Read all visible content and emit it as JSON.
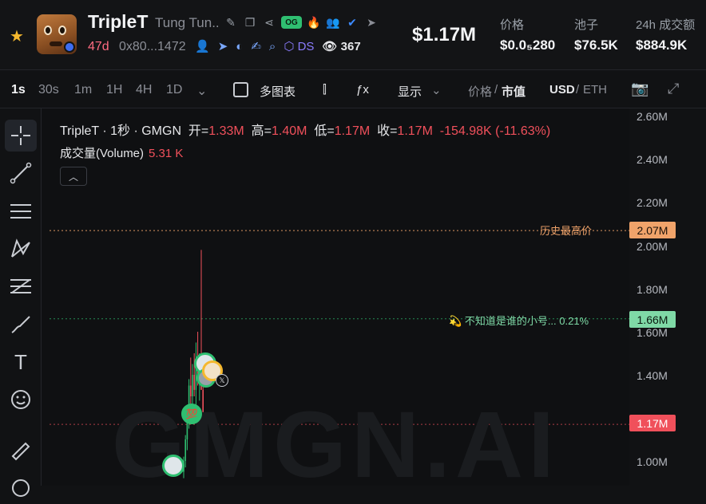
{
  "header": {
    "title": "TripleT",
    "subtitle": "Tung Tun...",
    "og_badge": "OG",
    "age": "47d",
    "address": "0x80...1472",
    "ds_label": "DS",
    "views": "367",
    "price_big": "$1.17M",
    "stats": [
      {
        "label": "价格",
        "value": "$0.0₅280"
      },
      {
        "label": "池子",
        "value": "$76.5K"
      },
      {
        "label": "24h 成交额",
        "value": "$884.9K"
      }
    ]
  },
  "toolbar": {
    "timeframes": [
      "1s",
      "30s",
      "1m",
      "1H",
      "4H",
      "1D"
    ],
    "active_timeframe": "1s",
    "multi_chart": "多图表",
    "display": "显示",
    "price_label": "价格",
    "slash": "/",
    "mcap_label": "市值",
    "usd": "USD",
    "eth": "ETH"
  },
  "legend": {
    "symbol": "TripleT · 1秒 · GMGN",
    "open_label": "开=",
    "open": "1.33M",
    "high_label": "高=",
    "high": "1.40M",
    "low_label": "低=",
    "low": "1.17M",
    "close_label": "收=",
    "close": "1.17M",
    "change": "-154.98K (-11.63%)",
    "volume_label": "成交量(Volume)",
    "volume": "5.31 K"
  },
  "chart": {
    "watermark": "GMGN.AI",
    "ath_label": "历史最高价",
    "ath_value": "2.07M",
    "whale_label": "不知道是谁的小号... 0.21%",
    "whale_value": "1.66M",
    "current_value": "1.17M",
    "y_ticks": [
      "2.60M",
      "2.40M",
      "2.20M",
      "2.00M",
      "1.80M",
      "1.60M",
      "1.40M",
      "1.00M"
    ],
    "colors": {
      "up": "#2fbf71",
      "down": "#f0505b",
      "ath": "#f0a36a"
    }
  },
  "chart_data": {
    "type": "candlestick",
    "title": "TripleT · 1秒 · GMGN",
    "xlabel": "",
    "ylabel": "",
    "ylim": [
      0.9,
      2.7
    ],
    "y_units": "M",
    "series": [
      {
        "values": [
          {
            "o": 0.95,
            "h": 1.02,
            "l": 0.92,
            "c": 1.0
          },
          {
            "o": 1.0,
            "h": 1.12,
            "l": 0.97,
            "c": 1.1
          },
          {
            "o": 1.1,
            "h": 1.22,
            "l": 1.05,
            "c": 1.2
          },
          {
            "o": 1.2,
            "h": 1.38,
            "l": 1.15,
            "c": 1.35
          },
          {
            "o": 1.35,
            "h": 1.48,
            "l": 1.25,
            "c": 1.3
          },
          {
            "o": 1.3,
            "h": 1.45,
            "l": 1.2,
            "c": 1.4
          },
          {
            "o": 1.4,
            "h": 1.5,
            "l": 1.3,
            "c": 1.33
          },
          {
            "o": 1.33,
            "h": 1.55,
            "l": 1.25,
            "c": 1.45
          },
          {
            "o": 1.45,
            "h": 1.6,
            "l": 1.35,
            "c": 1.38
          },
          {
            "o": 1.38,
            "h": 1.5,
            "l": 1.28,
            "c": 1.42
          },
          {
            "o": 1.42,
            "h": 1.98,
            "l": 1.35,
            "c": 1.33
          },
          {
            "o": 1.33,
            "h": 1.4,
            "l": 1.17,
            "c": 1.17
          }
        ]
      }
    ],
    "reference_lines": [
      {
        "label": "历史最高价",
        "value": 2.07
      },
      {
        "label": "不知道是谁的小号... 0.21%",
        "value": 1.66
      },
      {
        "label": "",
        "value": 1.17
      }
    ]
  }
}
